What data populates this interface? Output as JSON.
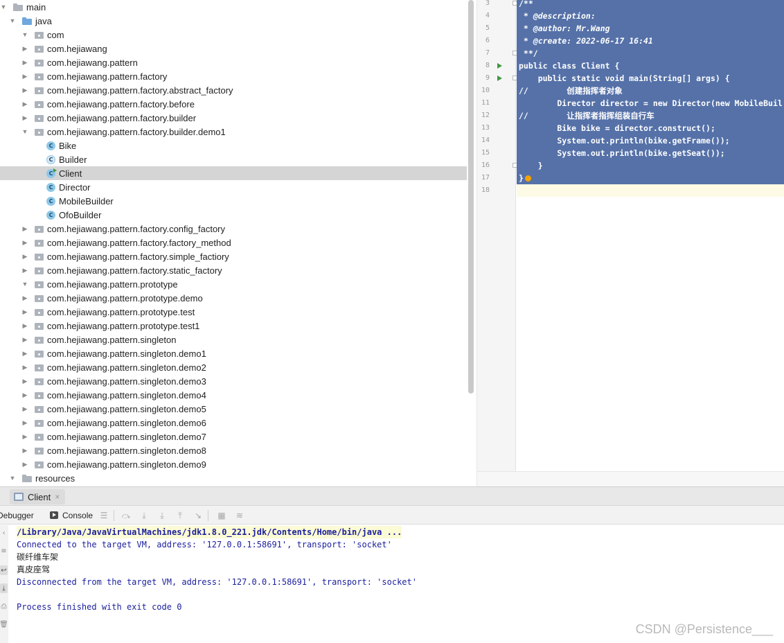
{
  "project_tree": {
    "rows": [
      {
        "label": "main",
        "kind": "folder",
        "arrow": "▼",
        "indent": 0
      },
      {
        "label": "java",
        "kind": "folder-blue",
        "arrow": "▼",
        "indent": 1
      },
      {
        "label": "com",
        "kind": "package",
        "arrow": "▼",
        "indent": 2
      },
      {
        "label": "com.hejiawang",
        "kind": "package",
        "arrow": "▶",
        "indent": 2
      },
      {
        "label": "com.hejiawang.pattern",
        "kind": "package",
        "arrow": "▶",
        "indent": 2
      },
      {
        "label": "com.hejiawang.pattern.factory",
        "kind": "package",
        "arrow": "▶",
        "indent": 2
      },
      {
        "label": "com.hejiawang.pattern.factory.abstract_factory",
        "kind": "package",
        "arrow": "▶",
        "indent": 2
      },
      {
        "label": "com.hejiawang.pattern.factory.before",
        "kind": "package",
        "arrow": "▶",
        "indent": 2
      },
      {
        "label": "com.hejiawang.pattern.factory.builder",
        "kind": "package",
        "arrow": "▶",
        "indent": 2
      },
      {
        "label": "com.hejiawang.pattern.factory.builder.demo1",
        "kind": "package",
        "arrow": "▼",
        "indent": 2
      },
      {
        "label": "Bike",
        "kind": "class",
        "arrow": "",
        "indent": 3
      },
      {
        "label": "Builder",
        "kind": "class-abstract",
        "arrow": "",
        "indent": 3
      },
      {
        "label": "Client",
        "kind": "class-runnable",
        "arrow": "",
        "indent": 3,
        "selected": true
      },
      {
        "label": "Director",
        "kind": "class",
        "arrow": "",
        "indent": 3
      },
      {
        "label": "MobileBuilder",
        "kind": "class",
        "arrow": "",
        "indent": 3
      },
      {
        "label": "OfoBuilder",
        "kind": "class",
        "arrow": "",
        "indent": 3
      },
      {
        "label": "com.hejiawang.pattern.factory.config_factory",
        "kind": "package",
        "arrow": "▶",
        "indent": 2
      },
      {
        "label": "com.hejiawang.pattern.factory.factory_method",
        "kind": "package",
        "arrow": "▶",
        "indent": 2
      },
      {
        "label": "com.hejiawang.pattern.factory.simple_factiory",
        "kind": "package",
        "arrow": "▶",
        "indent": 2
      },
      {
        "label": "com.hejiawang.pattern.factory.static_factory",
        "kind": "package",
        "arrow": "▶",
        "indent": 2
      },
      {
        "label": "com.hejiawang.pattern.prototype",
        "kind": "package",
        "arrow": "▼",
        "indent": 2
      },
      {
        "label": "com.hejiawang.pattern.prototype.demo",
        "kind": "package",
        "arrow": "▶",
        "indent": 2
      },
      {
        "label": "com.hejiawang.pattern.prototype.test",
        "kind": "package",
        "arrow": "▶",
        "indent": 2
      },
      {
        "label": "com.hejiawang.pattern.prototype.test1",
        "kind": "package",
        "arrow": "▶",
        "indent": 2
      },
      {
        "label": "com.hejiawang.pattern.singleton",
        "kind": "package",
        "arrow": "▶",
        "indent": 2
      },
      {
        "label": "com.hejiawang.pattern.singleton.demo1",
        "kind": "package",
        "arrow": "▶",
        "indent": 2
      },
      {
        "label": "com.hejiawang.pattern.singleton.demo2",
        "kind": "package",
        "arrow": "▶",
        "indent": 2
      },
      {
        "label": "com.hejiawang.pattern.singleton.demo3",
        "kind": "package",
        "arrow": "▶",
        "indent": 2
      },
      {
        "label": "com.hejiawang.pattern.singleton.demo4",
        "kind": "package",
        "arrow": "▶",
        "indent": 2
      },
      {
        "label": "com.hejiawang.pattern.singleton.demo5",
        "kind": "package",
        "arrow": "▶",
        "indent": 2
      },
      {
        "label": "com.hejiawang.pattern.singleton.demo6",
        "kind": "package",
        "arrow": "▶",
        "indent": 2
      },
      {
        "label": "com.hejiawang.pattern.singleton.demo7",
        "kind": "package",
        "arrow": "▶",
        "indent": 2
      },
      {
        "label": "com.hejiawang.pattern.singleton.demo8",
        "kind": "package",
        "arrow": "▶",
        "indent": 2
      },
      {
        "label": "com.hejiawang.pattern.singleton.demo9",
        "kind": "package",
        "arrow": "▶",
        "indent": 2
      },
      {
        "label": "resources",
        "kind": "folder-res",
        "arrow": "▼",
        "indent": 1
      }
    ]
  },
  "editor": {
    "lines": [
      {
        "num": "3",
        "text": "/**",
        "selected": true,
        "fold": true
      },
      {
        "num": "4",
        "text": " * @description:",
        "selected": true,
        "style": "it"
      },
      {
        "num": "5",
        "text": " * @author: Mr.Wang",
        "selected": true,
        "style": "it"
      },
      {
        "num": "6",
        "text": " * @create: 2022-06-17 16:41",
        "selected": true,
        "style": "it"
      },
      {
        "num": "7",
        "text": " **/",
        "selected": true,
        "fold": true
      },
      {
        "num": "8",
        "text": "public class Client {",
        "selected": true,
        "run": true
      },
      {
        "num": "9",
        "text": "    public static void main(String[] args) {",
        "selected": true,
        "run": true,
        "fold": true
      },
      {
        "num": "10",
        "text": "//        创建指挥者对象",
        "selected": true
      },
      {
        "num": "11",
        "text": "        Director director = new Director(new MobileBuil",
        "selected": true
      },
      {
        "num": "12",
        "text": "//        让指挥者指挥组装自行车",
        "selected": true
      },
      {
        "num": "13",
        "text": "        Bike bike = director.construct();",
        "selected": true
      },
      {
        "num": "14",
        "text": "        System.out.println(bike.getFrame());",
        "selected": true
      },
      {
        "num": "15",
        "text": "        System.out.println(bike.getSeat());",
        "selected": true
      },
      {
        "num": "16",
        "text": "    }",
        "selected": true,
        "fold": true
      },
      {
        "num": "17",
        "text": "}",
        "selected": true,
        "bulb": true
      },
      {
        "num": "18",
        "text": "",
        "selected": false,
        "current": true
      }
    ]
  },
  "run_window": {
    "tab_label": "Client",
    "tab_close": "×",
    "debugger_label": "Debugger",
    "console_label": "Console",
    "toolbar_icons": [
      "menu-icon",
      "step-over-icon",
      "step-into-icon",
      "force-step-into-icon",
      "step-out-icon",
      "run-to-cursor-icon",
      "evaluate-icon",
      "trace-icon"
    ]
  },
  "console": {
    "lines": [
      {
        "text": "/Library/Java/JavaVirtualMachines/jdk1.8.0_221.jdk/Contents/Home/bin/java ...",
        "type": "cmd"
      },
      {
        "text": "Connected to the target VM, address: '127.0.0.1:58691', transport: 'socket'",
        "type": "sys"
      },
      {
        "text": "碳纤维车架",
        "type": "out"
      },
      {
        "text": "真皮座驾",
        "type": "out"
      },
      {
        "text": "Disconnected from the target VM, address: '127.0.0.1:58691', transport: 'socket'",
        "type": "sys"
      },
      {
        "text": "",
        "type": "sys"
      },
      {
        "text": "Process finished with exit code 0",
        "type": "sys"
      }
    ]
  },
  "watermark": "CSDN @Persistence___"
}
